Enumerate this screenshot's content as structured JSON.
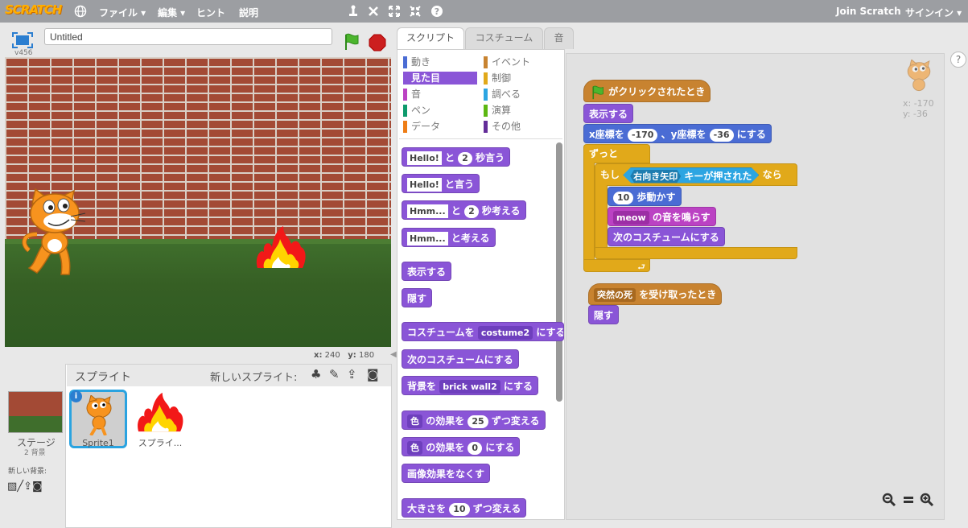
{
  "menubar": {
    "logo": "SCRATCH",
    "file": "ファイル ▾",
    "edit": "編集 ▾",
    "tips": "ヒント",
    "about": "説明",
    "join": "Join Scratch",
    "signin": "サインイン ▾"
  },
  "stage": {
    "version": "v456",
    "title": "Untitled",
    "x_label": "x:",
    "x_value": "240",
    "y_label": "y:",
    "y_value": "180"
  },
  "sprites_pane": {
    "header": "スプライト",
    "new_sprite": "新しいスプライト:",
    "stage_label": "ステージ",
    "stage_backdrops": "2 背景",
    "new_backdrop": "新しい背景:",
    "sprites": [
      "Sprite1",
      "スプライ..."
    ]
  },
  "tabs": [
    "スクリプト",
    "コスチューム",
    "音"
  ],
  "categories": [
    {
      "label": "動き",
      "color": "#4a6cd4"
    },
    {
      "label": "イベント",
      "color": "#c88330"
    },
    {
      "label": "見た目",
      "color": "#8a55d7"
    },
    {
      "label": "制御",
      "color": "#e1a91a"
    },
    {
      "label": "音",
      "color": "#bb42c3"
    },
    {
      "label": "調べる",
      "color": "#2ca5e2"
    },
    {
      "label": "ペン",
      "color": "#0e9a6c"
    },
    {
      "label": "演算",
      "color": "#5cb712"
    },
    {
      "label": "データ",
      "color": "#ee7d16"
    },
    {
      "label": "その他",
      "color": "#632d99"
    }
  ],
  "palette": {
    "say_for": {
      "text": "Hello!",
      "mid": "と",
      "secs": "2",
      "end": "秒言う"
    },
    "say": {
      "text": "Hello!",
      "end": "と言う"
    },
    "think_for": {
      "text": "Hmm...",
      "mid": "と",
      "secs": "2",
      "end": "秒考える"
    },
    "think": {
      "text": "Hmm...",
      "end": "と考える"
    },
    "show": "表示する",
    "hide": "隠す",
    "switch_costume": {
      "start": "コスチュームを",
      "value": "costume2",
      "end": "にする"
    },
    "next_costume": "次のコスチュームにする",
    "switch_backdrop": {
      "start": "背景を",
      "value": "brick wall2",
      "end": "にする"
    },
    "change_effect": {
      "effect": "色",
      "mid": "の効果を",
      "value": "25",
      "end": "ずつ変える"
    },
    "set_effect": {
      "effect": "色",
      "mid": "の効果を",
      "value": "0",
      "end": "にする"
    },
    "clear_effects": "画像効果をなくす",
    "change_size": {
      "start": "大きさを",
      "value": "10",
      "end": "ずつ変える"
    }
  },
  "script": {
    "flag_hat": "がクリックされたとき",
    "show": "表示する",
    "goto": {
      "x_label": "x座標を",
      "x": "-170",
      "mid": "、y座標を",
      "y": "-36",
      "end": "にする"
    },
    "forever": "ずっと",
    "if": {
      "start": "もし",
      "key": "右向き矢印",
      "mid": "キーが押された",
      "end": "なら"
    },
    "move": {
      "steps": "10",
      "end": "歩動かす"
    },
    "play_sound": {
      "sound": "meow",
      "end": "の音を鳴らす"
    },
    "next_costume": "次のコスチュームにする",
    "receive_hat": {
      "message": "突然の死",
      "end": "を受け取ったとき"
    },
    "hide": "隠す",
    "sprite_x": "x: -170",
    "sprite_y": "y: -36"
  }
}
